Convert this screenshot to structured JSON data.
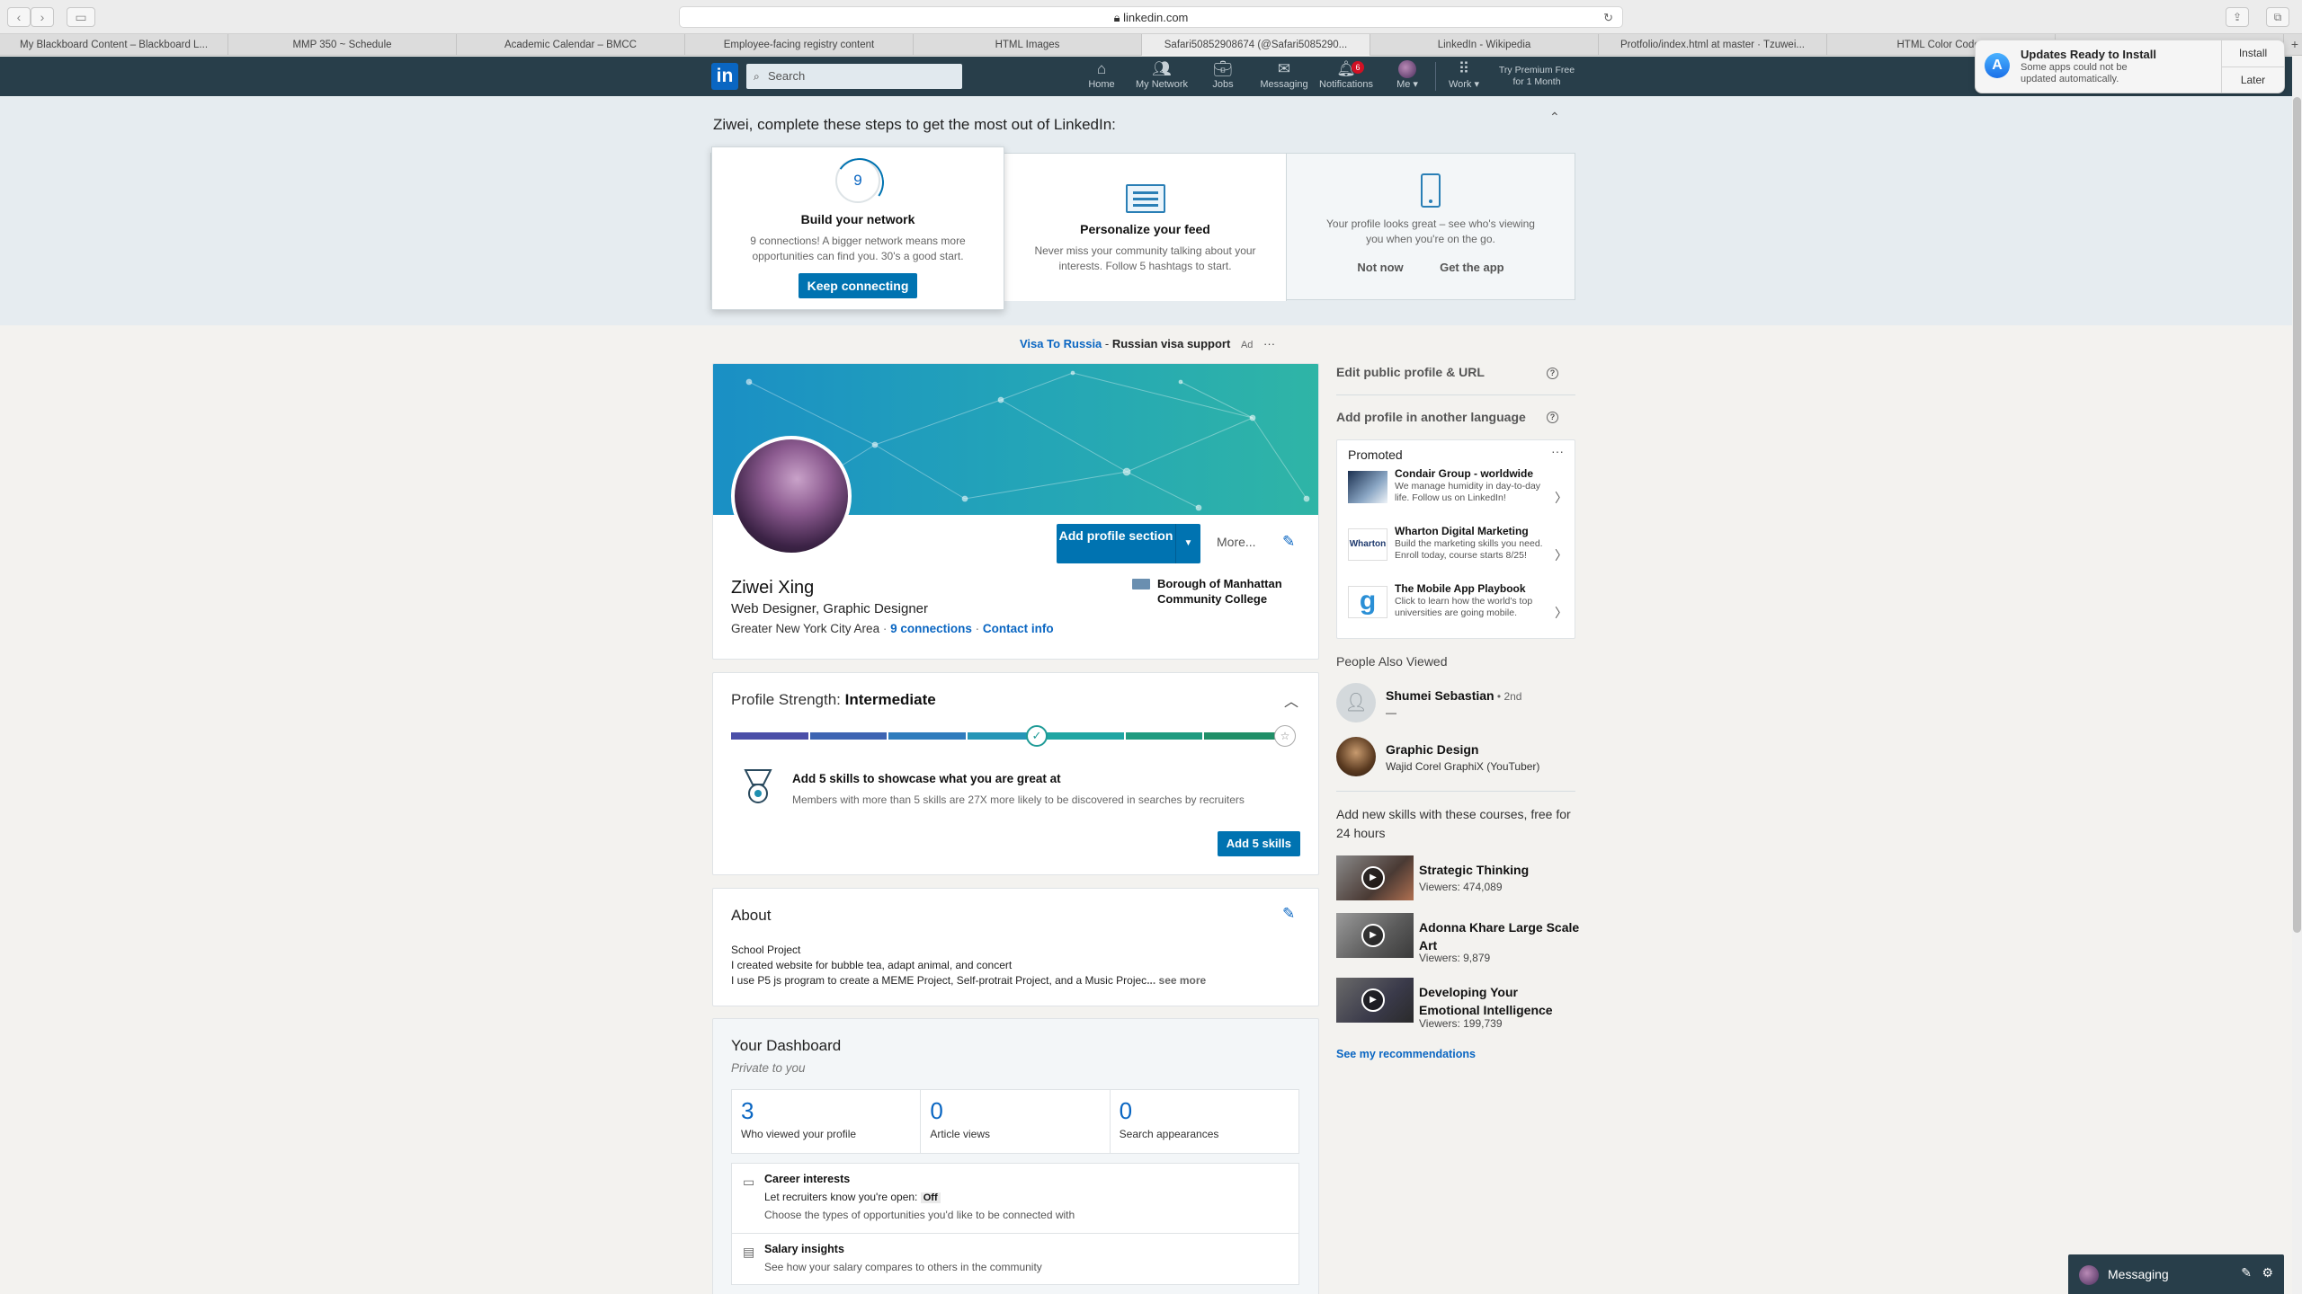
{
  "browser": {
    "url": "linkedin.com",
    "tabs": [
      "My Blackboard Content – Blackboard L...",
      "MMP 350 ~ Schedule",
      "Academic Calendar – BMCC",
      "Employee-facing registry content",
      "HTML Images",
      "Safari50852908674 (@Safari5085290...",
      "LinkedIn - Wikipedia",
      "Protfolio/index.html at master · Tzuwei...",
      "HTML Color Codes",
      "Updates Ready to Install"
    ]
  },
  "notification": {
    "title": "Updates Ready to Install",
    "body": "Some apps could not be updated automatically.",
    "install": "Install",
    "later": "Later"
  },
  "nav": {
    "logo": "in",
    "search_placeholder": "Search",
    "home": "Home",
    "network": "My Network",
    "jobs": "Jobs",
    "messaging": "Messaging",
    "notifications": "Notifications",
    "notifications_count": "6",
    "me": "Me",
    "work": "Work",
    "premium": "Try Premium Free for 1 Month"
  },
  "steps": {
    "title": "Ziwei, complete these steps to get the most out of LinkedIn:",
    "network": {
      "count": "9",
      "title": "Build your network",
      "body": "9 connections! A bigger network means more opportunities can find you. 30's a good start.",
      "button": "Keep connecting"
    },
    "feed": {
      "title": "Personalize your feed",
      "body": "Never miss your community talking about your interests. Follow 5 hashtags to start."
    },
    "app": {
      "body": "Your profile looks great – see who's viewing you when you're on the go.",
      "not_now": "Not now",
      "get_app": "Get the app"
    }
  },
  "ad": {
    "link": "Visa To Russia",
    "sep": " - ",
    "text": "Russian visa support",
    "label": "Ad",
    "more": "···"
  },
  "profile": {
    "add_section": "Add profile section",
    "more": "More...",
    "name": "Ziwei Xing",
    "headline": "Web Designer, Graphic Designer",
    "location": "Greater New York City Area",
    "connections": "9 connections",
    "contact": "Contact info",
    "school": "Borough of Manhattan Community College"
  },
  "strength": {
    "label": "Profile Strength: ",
    "level": "Intermediate",
    "progress": 0.45,
    "segment_colors": [
      "#4b4fa8",
      "#3d64b2",
      "#2f7cbd",
      "#2696b7",
      "#1fa6a3",
      "#1f9b80",
      "#208f68"
    ],
    "tip_title": "Add 5 skills to showcase what you are great at",
    "tip_body": "Members with more than 5 skills are 27X more likely to be discovered in searches by recruiters",
    "button": "Add 5 skills"
  },
  "about": {
    "title": "About",
    "line1": "School Project",
    "line2": "I created website for bubble tea, adapt animal, and concert",
    "line3": "I use P5 js program to create a MEME Project, Self-protrait Project, and a Music Projec",
    "see_more": "... see more"
  },
  "dashboard": {
    "title": "Your Dashboard",
    "subtitle": "Private to you",
    "stats": [
      {
        "value": "3",
        "label": "Who viewed your profile"
      },
      {
        "value": "0",
        "label": "Article views"
      },
      {
        "value": "0",
        "label": "Search appearances"
      }
    ],
    "career": {
      "title": "Career interests",
      "line1": "Let recruiters know you're open:",
      "state": "Off",
      "line2": "Choose the types of opportunities you'd like to be connected with"
    },
    "salary": {
      "title": "Salary insights",
      "line1": "See how your salary compares to others in the community"
    }
  },
  "rail": {
    "edit_url": "Edit public profile & URL",
    "add_language": "Add profile in another language",
    "promoted": "Promoted",
    "promos": [
      {
        "name": "Condair Group - worldwide",
        "desc": "We manage humidity in day-to-day life. Follow us on LinkedIn!"
      },
      {
        "name": "Wharton Digital Marketing",
        "desc": "Build the marketing skills you need. Enroll today, course starts 8/25!",
        "logo": "Wharton"
      },
      {
        "name": "The Mobile App Playbook",
        "desc": "Click to learn how the world's top universities are going mobile.",
        "logo": "g"
      }
    ],
    "people_title": "People Also Viewed",
    "people": [
      {
        "name": "Shumei Sebastian",
        "degree": " • 2nd",
        "sub": "—"
      },
      {
        "name": "Graphic Design",
        "degree": "",
        "sub": "Wajid Corel GraphiX (YouTuber)"
      }
    ],
    "courses_title": "Add new skills with these courses, free for 24 hours",
    "courses": [
      {
        "name": "Strategic Thinking",
        "views": "Viewers: 474,089"
      },
      {
        "name": "Adonna Khare Large Scale Art",
        "views": "Viewers: 9,879"
      },
      {
        "name": "Developing Your Emotional Intelligence",
        "views": "Viewers: 199,739"
      }
    ],
    "see_recs": "See my recommendations"
  },
  "messaging": {
    "label": "Messaging"
  }
}
